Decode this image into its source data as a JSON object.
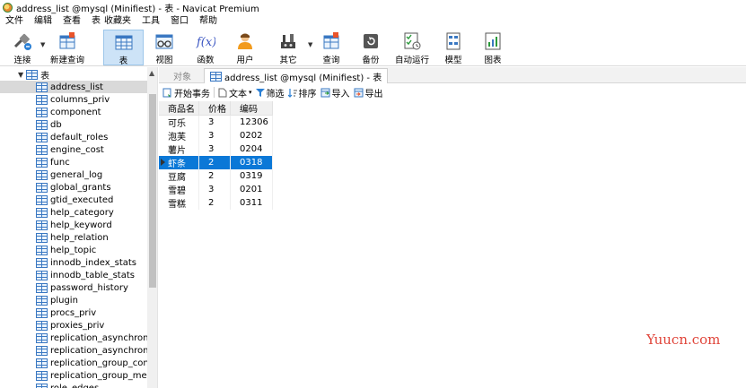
{
  "window": {
    "title": "address_list @mysql (Minifiest) - 表 - Navicat Premium"
  },
  "menu": [
    "文件",
    "编辑",
    "查看",
    "表",
    "收藏夹",
    "工具",
    "窗口",
    "帮助"
  ],
  "toolbar": {
    "connect": "连接",
    "new_query": "新建查询",
    "table": "表",
    "view": "视图",
    "function": "函数",
    "user": "用户",
    "other": "其它",
    "query": "查询",
    "backup": "备份",
    "auto_run": "自动运行",
    "model": "模型",
    "chart": "图表"
  },
  "sidebar": {
    "root_label": "表",
    "items": [
      "address_list",
      "columns_priv",
      "component",
      "db",
      "default_roles",
      "engine_cost",
      "func",
      "general_log",
      "global_grants",
      "gtid_executed",
      "help_category",
      "help_keyword",
      "help_relation",
      "help_topic",
      "innodb_index_stats",
      "innodb_table_stats",
      "password_history",
      "plugin",
      "procs_priv",
      "proxies_priv",
      "replication_asynchronous_",
      "replication_asynchronous_",
      "replication_group_configu",
      "replication_group_membe",
      "role_edges"
    ],
    "selected_index": 0
  },
  "tabs": {
    "objects": "对象",
    "current": "address_list @mysql (Minifiest) - 表"
  },
  "subtoolbar": {
    "begin_transaction": "开始事务",
    "text": "文本",
    "filter": "筛选",
    "sort": "排序",
    "import": "导入",
    "export": "导出"
  },
  "table": {
    "columns": [
      "商品名",
      "价格",
      "编码"
    ],
    "rows": [
      [
        "可乐",
        "3",
        "12306"
      ],
      [
        "泡芙",
        "3",
        "0202"
      ],
      [
        "薯片",
        "3",
        "0204"
      ],
      [
        "虾条",
        "2",
        "0318"
      ],
      [
        "豆腐",
        "2",
        "0319"
      ],
      [
        "雪碧",
        "3",
        "0201"
      ],
      [
        "雪糕",
        "2",
        "0311"
      ]
    ],
    "selected_row": 3
  },
  "watermark": "Yuucn.com"
}
